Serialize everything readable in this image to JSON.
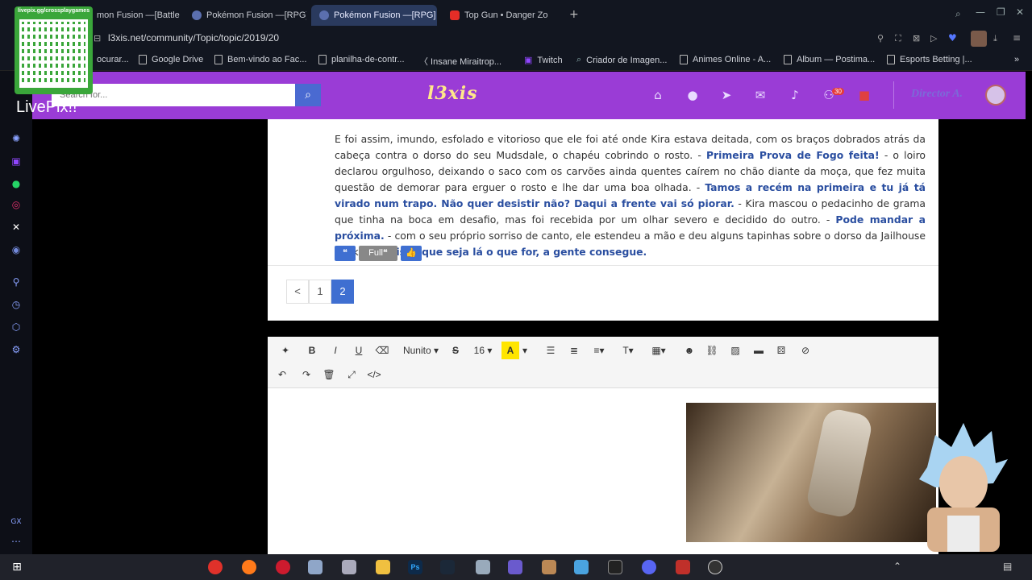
{
  "browser": {
    "tabs": [
      {
        "label": "mon Fusion —[Battle"
      },
      {
        "label": "Pokémon Fusion —[RPG]"
      },
      {
        "label": "Pokémon Fusion —[RPG]"
      },
      {
        "label": "Top Gun • Danger Zo"
      }
    ],
    "url": "l3xis.net/community/Topic/topic/2019/20",
    "bookmarks": [
      "ocurar...",
      "Google Drive",
      "Bem-vindo ao Fac...",
      "planilha-de-contr...",
      "〈 Insane Miraitrop...",
      "Twitch",
      "Criador de Imagen...",
      "Animes Online - A...",
      "Album — Postima...",
      "Esports Betting |..."
    ]
  },
  "overlay": {
    "qr_label": "livepix.gg/crossplaygames",
    "livepix": "LivePix!!"
  },
  "site": {
    "search_placeholder": "Search for...",
    "logo": "l3xis",
    "notification_count": "30",
    "username": "Director A."
  },
  "post": {
    "segments": [
      {
        "text": "E foi assim, imundo, esfolado e vitorioso que ele foi até onde Kira estava deitada, com os braços dobrados atrás da cabeça contra o dorso do seu Mudsdale, o chapéu cobrindo o rosto. - ",
        "hl": false
      },
      {
        "text": "Primeira Prova de Fogo feita!",
        "hl": true
      },
      {
        "text": " - o loiro declarou orgulhoso, deixando o saco com os carvões ainda quentes caírem no chão diante da moça, que fez muita questão de demorar para erguer o rosto e lhe dar uma boa olhada. - ",
        "hl": false
      },
      {
        "text": "Tamos a recém na primeira e tu já tá virado num trapo. Não quer desistir não? Daqui a frente vai só piorar.",
        "hl": true
      },
      {
        "text": " - Kira mascou o pedacinho de grama que tinha na boca em desafio, mas foi recebida por um olhar severo e decidido do outro. - ",
        "hl": false
      },
      {
        "text": "Pode mandar a próxima.",
        "hl": true
      },
      {
        "text": " - com o seu próprio sorriso de canto, ele estendeu a mão e deu alguns tapinhas sobre o dorso da Jailhouse Rock. - ",
        "hl": false
      },
      {
        "text": "Eu disse que seja lá o que for, a gente consegue.",
        "hl": true
      }
    ],
    "quote_label": "❝",
    "full_quote_label": "Full❝",
    "like_label": "👍"
  },
  "pagination": {
    "prev": "<",
    "pages": [
      "1",
      "2"
    ],
    "current": "2"
  },
  "editor": {
    "font_family": "Nunito",
    "font_size": "16"
  },
  "colors": {
    "header": "#9a3cd6",
    "accent": "#3f6fd1",
    "highlight_text": "#2a4ea0"
  }
}
